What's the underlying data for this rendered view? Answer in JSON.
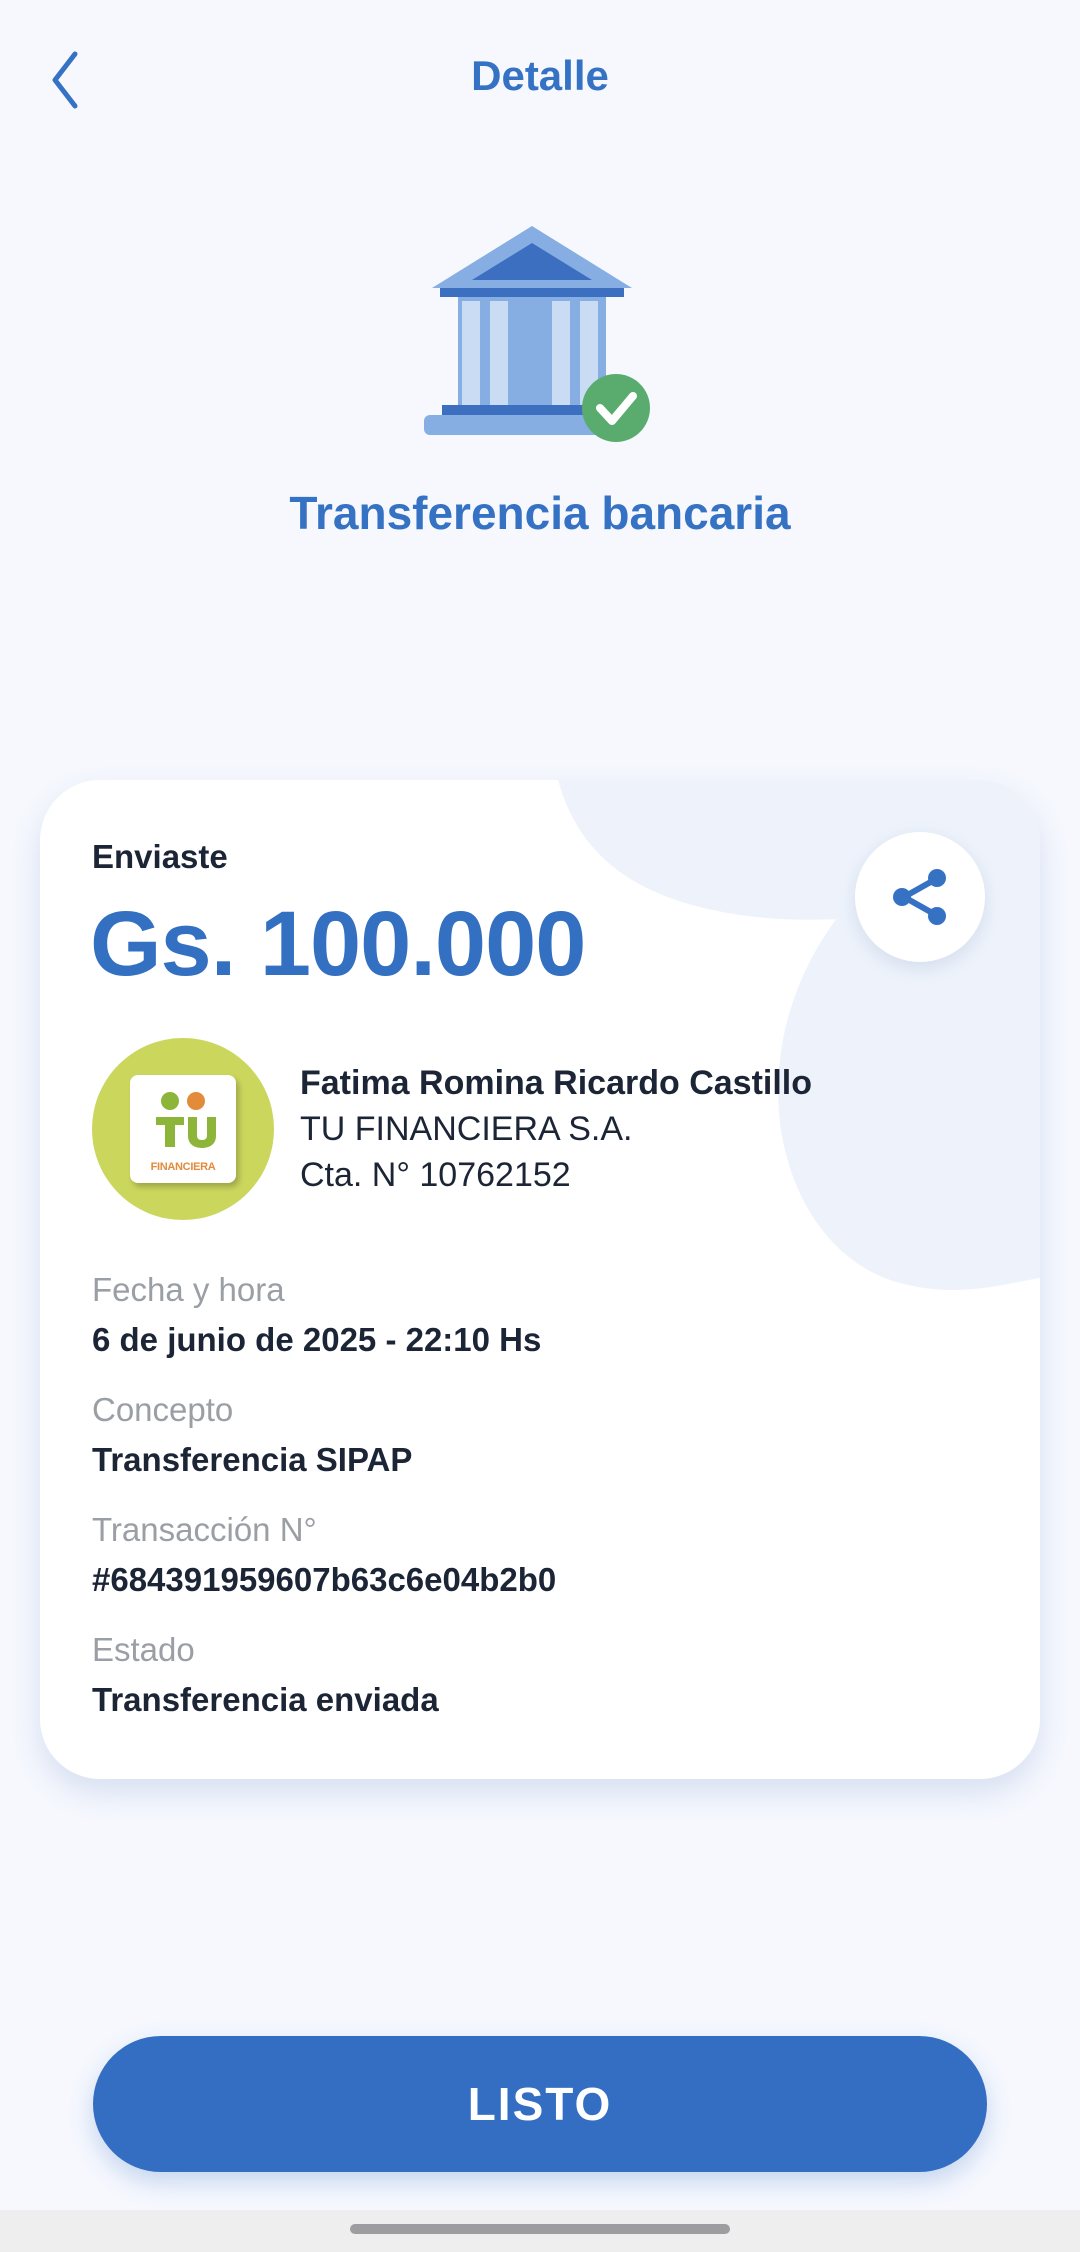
{
  "header": {
    "title": "Detalle",
    "back_icon": "chevron-left-icon"
  },
  "operation": {
    "title": "Transferencia bancaria",
    "icon": "bank-check-icon"
  },
  "summary": {
    "label": "Enviaste",
    "amount": "Gs. 100.000",
    "share_icon": "share-icon"
  },
  "recipient": {
    "name": "Fatima Romina Ricardo Castillo",
    "bank": "TU FINANCIERA S.A.",
    "account": "Cta. N° 10762152",
    "logo_text": "FINANCIERA"
  },
  "details": [
    {
      "label": "Fecha y hora",
      "value": "6 de junio de 2025 - 22:10 Hs"
    },
    {
      "label": "Concepto",
      "value": "Transferencia SIPAP"
    },
    {
      "label": "Transacción N°",
      "value": "#684391959607b63c6e04b2b0"
    },
    {
      "label": "Estado",
      "value": "Transferencia enviada"
    }
  ],
  "actions": {
    "done_label": "LISTO"
  },
  "colors": {
    "accent": "#3370c2",
    "background": "#f6f8fe",
    "success": "#5aab6e",
    "avatar_bg": "#cbd65c"
  }
}
